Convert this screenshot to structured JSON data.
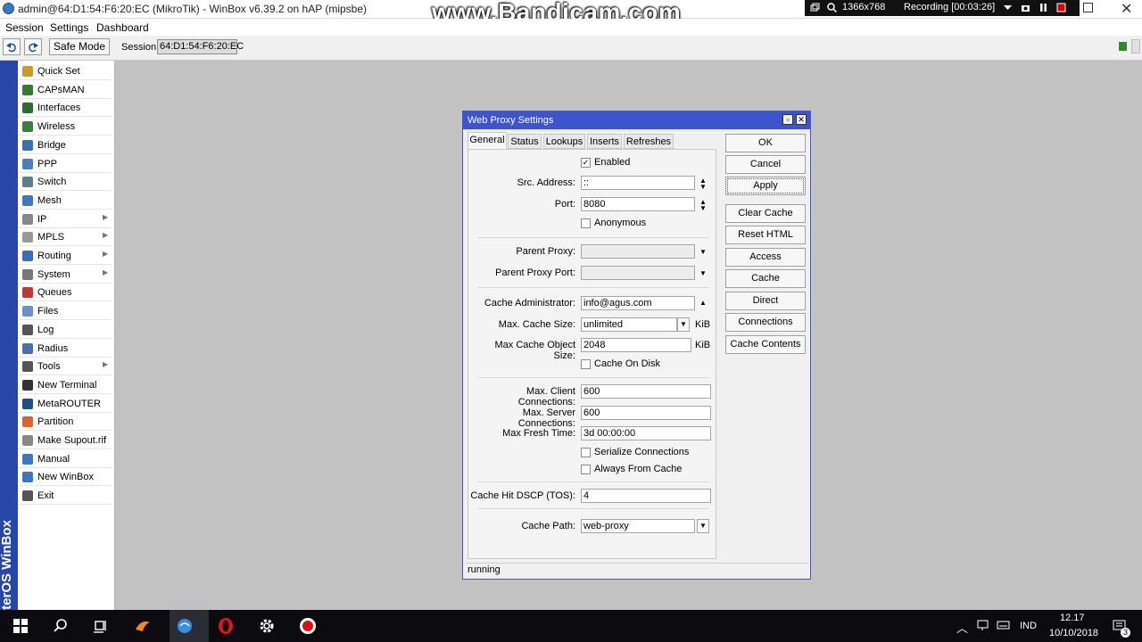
{
  "window": {
    "title": "admin@64:D1:54:F6:20:EC (MikroTik) - WinBox v6.39.2 on hAP (mipsbe)",
    "watermark": "www.Bandicam.com",
    "recorder": {
      "resolution": "1366x768",
      "status": "Recording [00:03:26]"
    }
  },
  "menu": {
    "items": [
      "Session",
      "Settings",
      "Dashboard"
    ]
  },
  "toolbar": {
    "safe_mode_label": "Safe Mode",
    "session_label": "Session:",
    "session_value": "64:D1:54:F6:20:EC"
  },
  "sidebar": {
    "vertical_label": "RouterOS WinBox",
    "items": [
      {
        "label": "Quick Set",
        "icon": "quick-set-icon",
        "submenu": false
      },
      {
        "label": "CAPsMAN",
        "icon": "capsman-icon",
        "submenu": false
      },
      {
        "label": "Interfaces",
        "icon": "interfaces-icon",
        "submenu": false
      },
      {
        "label": "Wireless",
        "icon": "wireless-icon",
        "submenu": false
      },
      {
        "label": "Bridge",
        "icon": "bridge-icon",
        "submenu": false
      },
      {
        "label": "PPP",
        "icon": "ppp-icon",
        "submenu": false
      },
      {
        "label": "Switch",
        "icon": "switch-icon",
        "submenu": false
      },
      {
        "label": "Mesh",
        "icon": "mesh-icon",
        "submenu": false
      },
      {
        "label": "IP",
        "icon": "ip-icon",
        "submenu": true
      },
      {
        "label": "MPLS",
        "icon": "mpls-icon",
        "submenu": true
      },
      {
        "label": "Routing",
        "icon": "routing-icon",
        "submenu": true
      },
      {
        "label": "System",
        "icon": "system-icon",
        "submenu": true
      },
      {
        "label": "Queues",
        "icon": "queues-icon",
        "submenu": false
      },
      {
        "label": "Files",
        "icon": "files-icon",
        "submenu": false
      },
      {
        "label": "Log",
        "icon": "log-icon",
        "submenu": false
      },
      {
        "label": "Radius",
        "icon": "radius-icon",
        "submenu": false
      },
      {
        "label": "Tools",
        "icon": "tools-icon",
        "submenu": true
      },
      {
        "label": "New Terminal",
        "icon": "terminal-icon",
        "submenu": false
      },
      {
        "label": "MetaROUTER",
        "icon": "metarouter-icon",
        "submenu": false
      },
      {
        "label": "Partition",
        "icon": "partition-icon",
        "submenu": false
      },
      {
        "label": "Make Supout.rif",
        "icon": "supout-icon",
        "submenu": false
      },
      {
        "label": "Manual",
        "icon": "manual-icon",
        "submenu": false
      },
      {
        "label": "New WinBox",
        "icon": "winbox-icon",
        "submenu": false
      },
      {
        "label": "Exit",
        "icon": "exit-icon",
        "submenu": false
      }
    ]
  },
  "dialog": {
    "title": "Web Proxy Settings",
    "tabs": [
      "General",
      "Status",
      "Lookups",
      "Inserts",
      "Refreshes"
    ],
    "active_tab": "General",
    "fields": {
      "enabled_label": "Enabled",
      "enabled": true,
      "src_address_label": "Src. Address:",
      "src_address": "::",
      "port_label": "Port:",
      "port": "8080",
      "anonymous_label": "Anonymous",
      "parent_proxy_label": "Parent Proxy:",
      "parent_proxy_port_label": "Parent Proxy Port:",
      "cache_admin_label": "Cache Administrator:",
      "cache_admin": "info@agus.com",
      "max_cache_size_label": "Max. Cache Size:",
      "max_cache_size": "unlimited",
      "max_cache_size_unit": "KiB",
      "max_cache_obj_label": "Max Cache Object Size:",
      "max_cache_obj": "2048",
      "max_cache_obj_unit": "KiB",
      "cache_on_disk_label": "Cache On Disk",
      "max_client_conn_label": "Max. Client Connections:",
      "max_client_conn": "600",
      "max_server_conn_label": "Max. Server Connections:",
      "max_server_conn": "600",
      "max_fresh_time_label": "Max Fresh Time:",
      "max_fresh_time": "3d 00:00:00",
      "serialize_label": "Serialize Connections",
      "always_from_cache_label": "Always From Cache",
      "cache_hit_dscp_label": "Cache Hit DSCP (TOS):",
      "cache_hit_dscp": "4",
      "cache_path_label": "Cache Path:",
      "cache_path": "web-proxy"
    },
    "buttons": [
      "OK",
      "Cancel",
      "Apply",
      "Clear Cache",
      "Reset HTML",
      "Access",
      "Cache",
      "Direct",
      "Connections",
      "Cache Contents"
    ],
    "status": "running"
  },
  "taskbar": {
    "language": "IND",
    "time": "12.17",
    "date": "10/10/2018",
    "notifications": "3"
  }
}
